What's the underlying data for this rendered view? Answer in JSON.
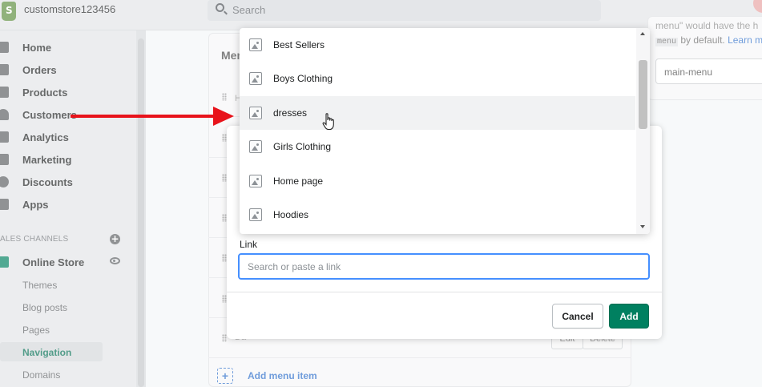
{
  "topbar": {
    "store_name": "customstore123456",
    "search_placeholder": "Search"
  },
  "sidebar": {
    "items": [
      {
        "label": "Home",
        "icon": "home-icon"
      },
      {
        "label": "Orders",
        "icon": "orders-icon"
      },
      {
        "label": "Products",
        "icon": "tag-icon"
      },
      {
        "label": "Customers",
        "icon": "person-icon"
      },
      {
        "label": "Analytics",
        "icon": "bar-chart-icon"
      },
      {
        "label": "Marketing",
        "icon": "megaphone-icon"
      },
      {
        "label": "Discounts",
        "icon": "discount-icon"
      },
      {
        "label": "Apps",
        "icon": "apps-icon"
      }
    ],
    "sales_channels_header": "ALES CHANNELS",
    "online_store": "Online Store",
    "sub_items": [
      "Themes",
      "Blog posts",
      "Pages",
      "Navigation",
      "Domains"
    ],
    "active_sub_item": "Navigation"
  },
  "main": {
    "card_title": "Men",
    "row_h": "H",
    "row_partial_label": "Da",
    "edit_label": "Edit",
    "delete_label": "Delete",
    "add_menu_item": "Add menu item"
  },
  "right_panel": {
    "help_text_top": "menu\" would have the h",
    "code": "menu",
    "help_text": "by default.",
    "learn_more": "Learn mo",
    "handle_value": "main-menu"
  },
  "modal": {
    "link_label": "Link",
    "link_placeholder": "Search or paste a link",
    "cancel_label": "Cancel",
    "add_label": "Add"
  },
  "dropdown": {
    "items": [
      "Best Sellers",
      "Boys Clothing",
      "dresses",
      "Girls Clothing",
      "Home page",
      "Hoodies"
    ],
    "hovered_item": "dresses"
  },
  "colors": {
    "primary": "#008060",
    "link": "#2c6ecb",
    "focus": "#458fff",
    "annotation_arrow": "#e8131b"
  }
}
